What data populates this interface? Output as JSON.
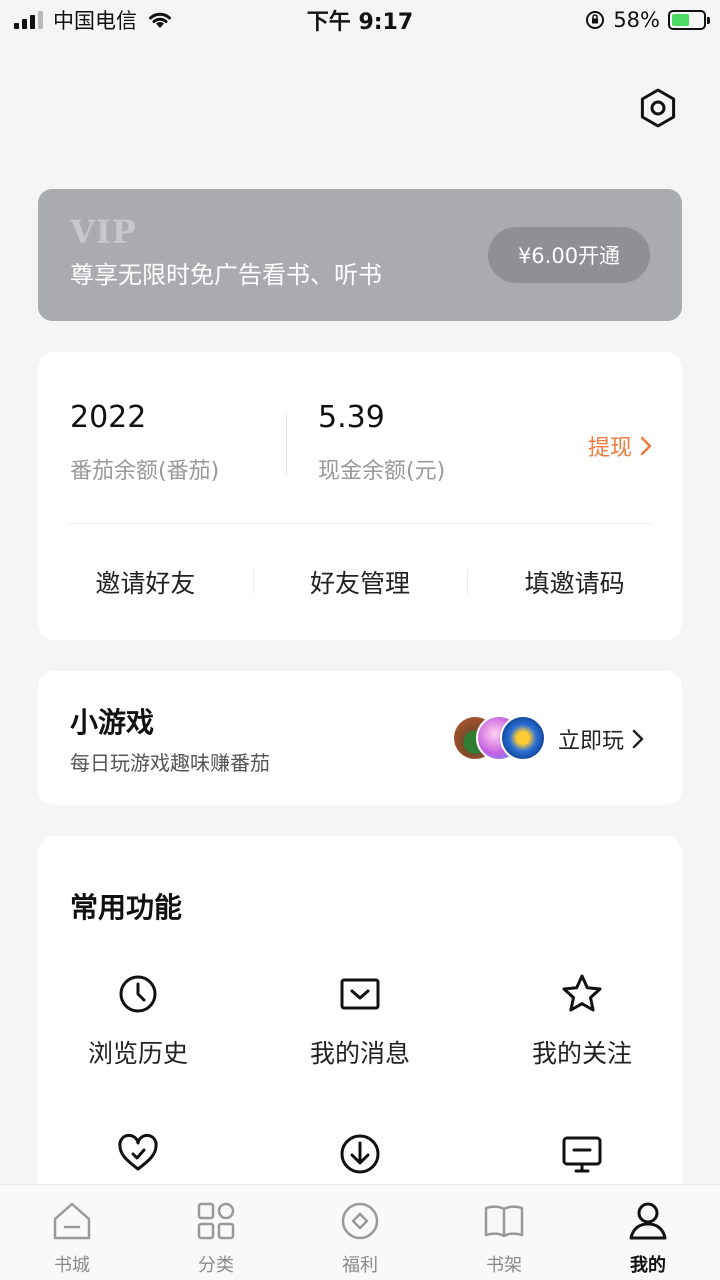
{
  "status_bar": {
    "carrier": "中国电信",
    "time": "下午 9:17",
    "battery": "58%"
  },
  "vip": {
    "logo": "VIP",
    "description": "尊享无限时免广告看书、听书",
    "button": "¥6.00开通"
  },
  "wallet": {
    "tomato_balance": "2022",
    "tomato_label": "番茄余额(番茄)",
    "cash_balance": "5.39",
    "cash_label": "现金余额(元)",
    "withdraw": "提现",
    "actions": [
      "邀请好友",
      "好友管理",
      "填邀请码"
    ]
  },
  "mini_games": {
    "title": "小游戏",
    "subtitle": "每日玩游戏趣味赚番茄",
    "play": "立即玩"
  },
  "features": {
    "title": "常用功能",
    "items": [
      {
        "label": "浏览历史",
        "icon": "clock-icon"
      },
      {
        "label": "我的消息",
        "icon": "message-icon"
      },
      {
        "label": "我的关注",
        "icon": "star-icon"
      },
      {
        "label": "",
        "icon": "heart-icon"
      },
      {
        "label": "",
        "icon": "download-icon"
      },
      {
        "label": "",
        "icon": "monitor-icon"
      }
    ]
  },
  "tabs": [
    {
      "label": "书城",
      "icon": "home-icon"
    },
    {
      "label": "分类",
      "icon": "grid-icon"
    },
    {
      "label": "福利",
      "icon": "coin-icon"
    },
    {
      "label": "书架",
      "icon": "book-icon"
    },
    {
      "label": "我的",
      "icon": "user-icon",
      "active": true
    }
  ],
  "colors": {
    "accent": "#f07b3f",
    "vip_card": "#a9abaf",
    "battery_fill": "#4cd964"
  }
}
